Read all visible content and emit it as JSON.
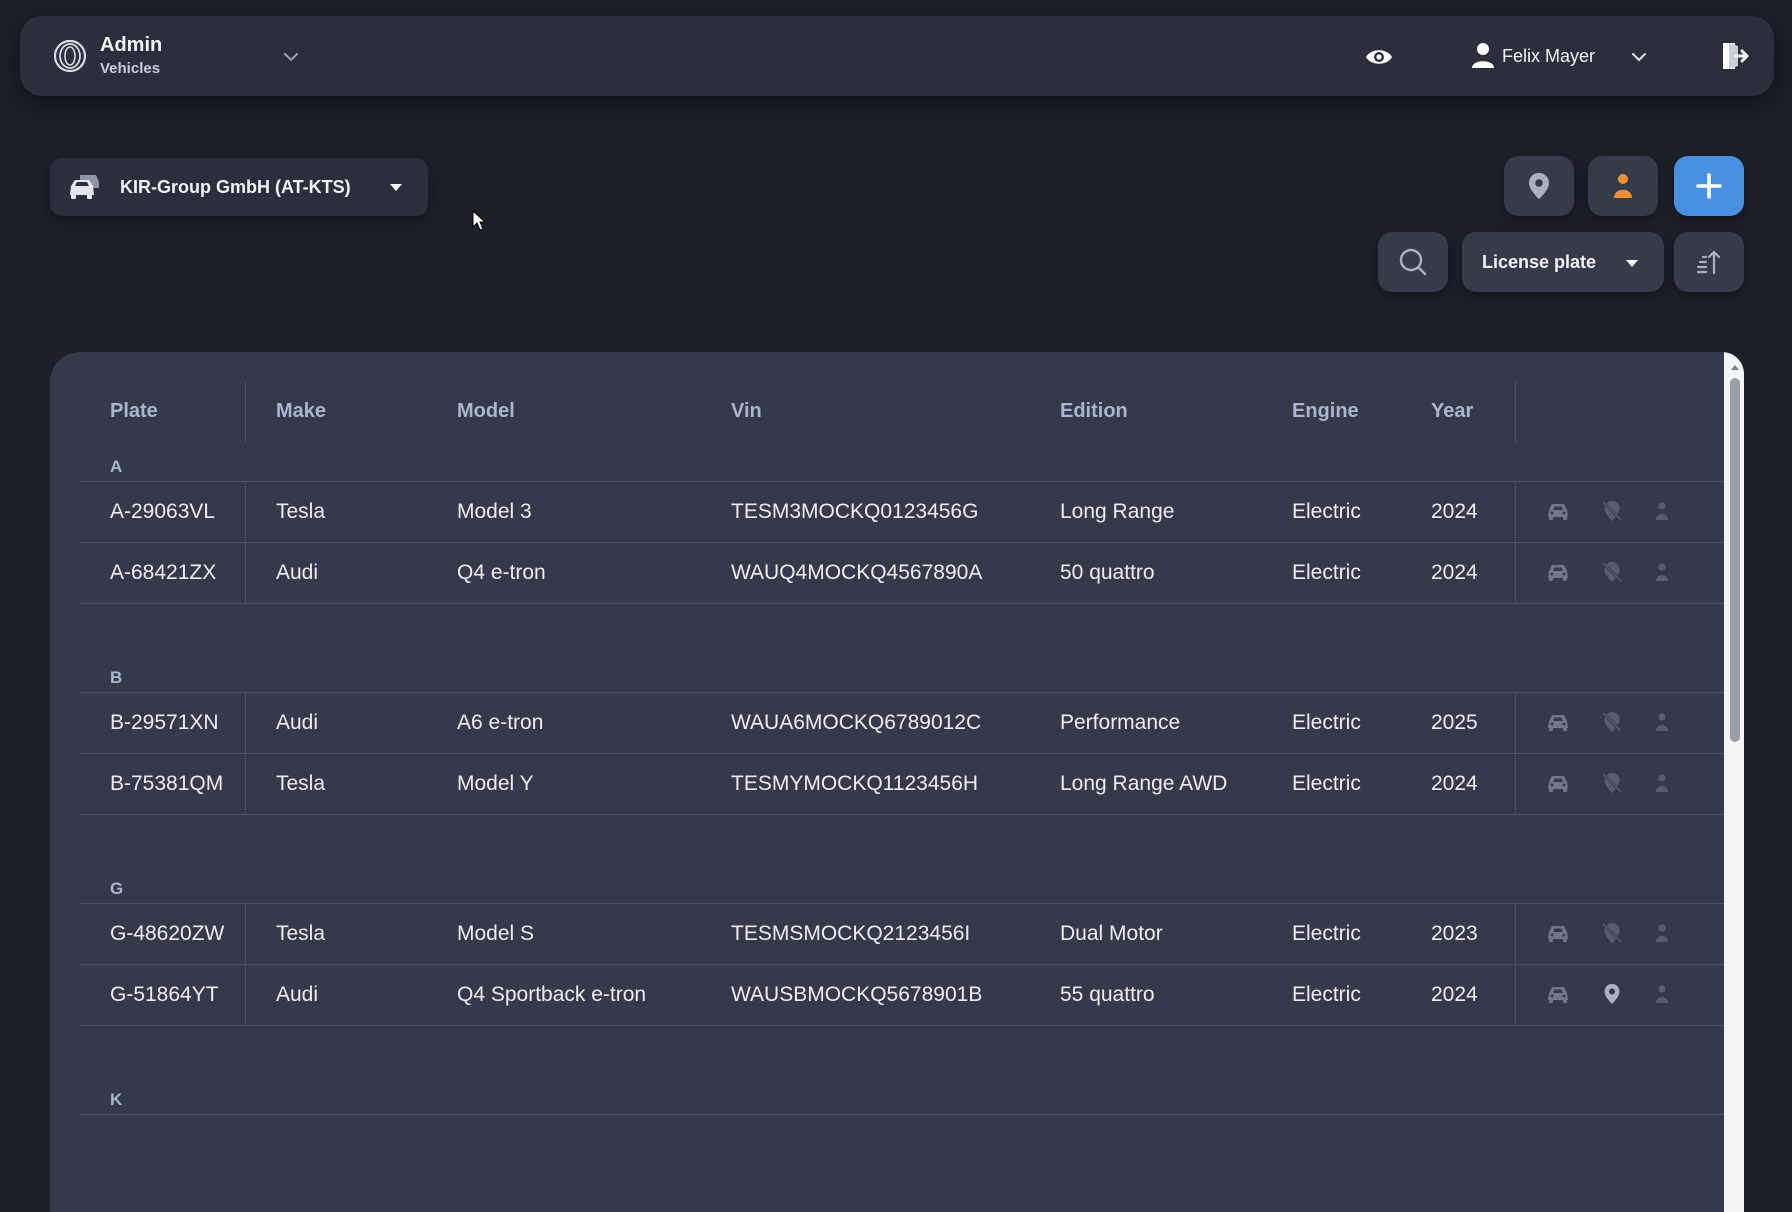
{
  "header": {
    "app_title": "Admin",
    "app_subtitle": "Vehicles",
    "user_name": "Felix Mayer"
  },
  "toolbar": {
    "company_label": "KIR-Group GmbH (AT-KTS)",
    "sort_label": "License plate"
  },
  "colors": {
    "background": "#1c2029",
    "panel": "#343a4a",
    "accent_blue": "#4a90e2",
    "person_orange": "#f0903a",
    "header_text": "#aab5cf"
  },
  "icons": {
    "logo": "brand-logo-icon",
    "eye": "eye-icon",
    "user": "user-icon",
    "logout": "logout-icon",
    "company": "cars-icon",
    "location": "map-pin-icon",
    "person": "person-icon",
    "add": "plus-icon",
    "search": "search-icon",
    "sort": "sort-ascending-icon"
  },
  "table": {
    "columns": [
      "Plate",
      "Make",
      "Model",
      "Vin",
      "Edition",
      "Engine",
      "Year"
    ],
    "groups": [
      {
        "letter": "A",
        "rows": [
          {
            "plate": "A-29063VL",
            "make": "Tesla",
            "model": "Model 3",
            "vin": "TESM3MOCKQ0123456G",
            "edition": "Long Range",
            "engine": "Electric",
            "year": "2024",
            "location_active": false
          },
          {
            "plate": "A-68421ZX",
            "make": "Audi",
            "model": "Q4 e-tron",
            "vin": "WAUQ4MOCKQ4567890A",
            "edition": "50 quattro",
            "engine": "Electric",
            "year": "2024",
            "location_active": false
          }
        ]
      },
      {
        "letter": "B",
        "rows": [
          {
            "plate": "B-29571XN",
            "make": "Audi",
            "model": "A6 e-tron",
            "vin": "WAUA6MOCKQ6789012C",
            "edition": "Performance",
            "engine": "Electric",
            "year": "2025",
            "location_active": false
          },
          {
            "plate": "B-75381QM",
            "make": "Tesla",
            "model": "Model Y",
            "vin": "TESMYMOCKQ1123456H",
            "edition": "Long Range AWD",
            "engine": "Electric",
            "year": "2024",
            "location_active": false
          }
        ]
      },
      {
        "letter": "G",
        "rows": [
          {
            "plate": "G-48620ZW",
            "make": "Tesla",
            "model": "Model S",
            "vin": "TESMSMOCKQ2123456I",
            "edition": "Dual Motor",
            "engine": "Electric",
            "year": "2023",
            "location_active": false
          },
          {
            "plate": "G-51864YT",
            "make": "Audi",
            "model": "Q4 Sportback e-tron",
            "vin": "WAUSBMOCKQ5678901B",
            "edition": "55 quattro",
            "engine": "Electric",
            "year": "2024",
            "location_active": true
          }
        ]
      },
      {
        "letter": "K",
        "rows": []
      }
    ]
  }
}
